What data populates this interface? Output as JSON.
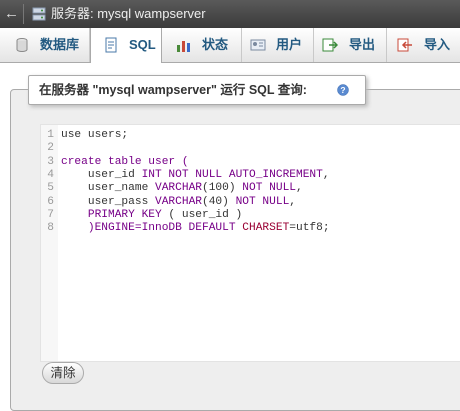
{
  "window": {
    "title": "服务器: mysql wampserver",
    "back_glyph": "←"
  },
  "tabs": [
    {
      "label": "数据库",
      "icon": "database-icon",
      "active": false
    },
    {
      "label": "SQL",
      "icon": "sql-icon",
      "active": true
    },
    {
      "label": "状态",
      "icon": "status-chart-icon",
      "active": false
    },
    {
      "label": "用户",
      "icon": "users-icon",
      "active": false
    },
    {
      "label": "导出",
      "icon": "export-icon",
      "active": false
    },
    {
      "label": "导入",
      "icon": "import-icon",
      "active": false
    }
  ],
  "query_panel": {
    "legend": "在服务器 \"mysql wampserver\" 运行 SQL 查询:",
    "help_icon": "help-icon"
  },
  "editor": {
    "line_numbers": [
      "1",
      "2",
      "3",
      "4",
      "5",
      "6",
      "7",
      "8"
    ],
    "lines": [
      [
        {
          "t": "use users;",
          "c": "plain"
        }
      ],
      [],
      [
        {
          "t": "create table user (",
          "c": "kw"
        }
      ],
      [
        {
          "t": "    user_id ",
          "c": "plain"
        },
        {
          "t": "INT NOT NULL AUTO_INCREMENT",
          "c": "kw"
        },
        {
          "t": ",",
          "c": "plain"
        }
      ],
      [
        {
          "t": "    user_name ",
          "c": "plain"
        },
        {
          "t": "VARCHAR",
          "c": "kw"
        },
        {
          "t": "(100) ",
          "c": "plain"
        },
        {
          "t": "NOT NULL",
          "c": "kw"
        },
        {
          "t": ",",
          "c": "plain"
        }
      ],
      [
        {
          "t": "    user_pass ",
          "c": "plain"
        },
        {
          "t": "VARCHAR",
          "c": "kw"
        },
        {
          "t": "(40) ",
          "c": "plain"
        },
        {
          "t": "NOT NULL",
          "c": "kw"
        },
        {
          "t": ",",
          "c": "plain"
        }
      ],
      [
        {
          "t": "    PRIMARY KEY ",
          "c": "kw"
        },
        {
          "t": "( user_id )",
          "c": "plain"
        }
      ],
      [
        {
          "t": "    )ENGINE=InnoDB DEFAULT ",
          "c": "kw"
        },
        {
          "t": "CHARSET",
          "c": "kw2"
        },
        {
          "t": "=utf8;",
          "c": "plain"
        }
      ]
    ]
  },
  "buttons": {
    "clear": "清除"
  },
  "colors": {
    "tab_text": "#235a81",
    "keyword": "#770088",
    "keyword_alt": "#990033",
    "panel_bg": "#eeeeee",
    "titlebar_bg": "#4a4a4a"
  }
}
